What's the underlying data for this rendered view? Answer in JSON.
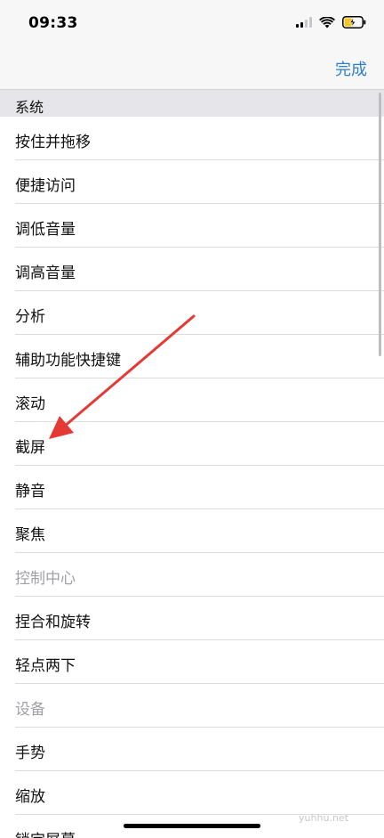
{
  "status_bar": {
    "time": "09:33",
    "battery_color": "#f3c623"
  },
  "nav": {
    "done_label": "完成",
    "accent_color": "#2f7fd0"
  },
  "section": {
    "title": "系统"
  },
  "items": [
    {
      "label": "按住并拖移",
      "enabled": true
    },
    {
      "label": "便捷访问",
      "enabled": true
    },
    {
      "label": "调低音量",
      "enabled": true
    },
    {
      "label": "调高音量",
      "enabled": true
    },
    {
      "label": "分析",
      "enabled": true
    },
    {
      "label": "辅助功能快捷键",
      "enabled": true
    },
    {
      "label": "滚动",
      "enabled": true
    },
    {
      "label": "截屏",
      "enabled": true
    },
    {
      "label": "静音",
      "enabled": true
    },
    {
      "label": "聚焦",
      "enabled": true
    },
    {
      "label": "控制中心",
      "enabled": false
    },
    {
      "label": "捏合和旋转",
      "enabled": true
    },
    {
      "label": "轻点两下",
      "enabled": true
    },
    {
      "label": "设备",
      "enabled": false
    },
    {
      "label": "手势",
      "enabled": true
    },
    {
      "label": "缩放",
      "enabled": true
    },
    {
      "label": "锁定屏幕",
      "enabled": true
    }
  ],
  "annotation": {
    "color": "#e53935",
    "points_to": "截屏"
  },
  "watermark": "yuhhu.net"
}
